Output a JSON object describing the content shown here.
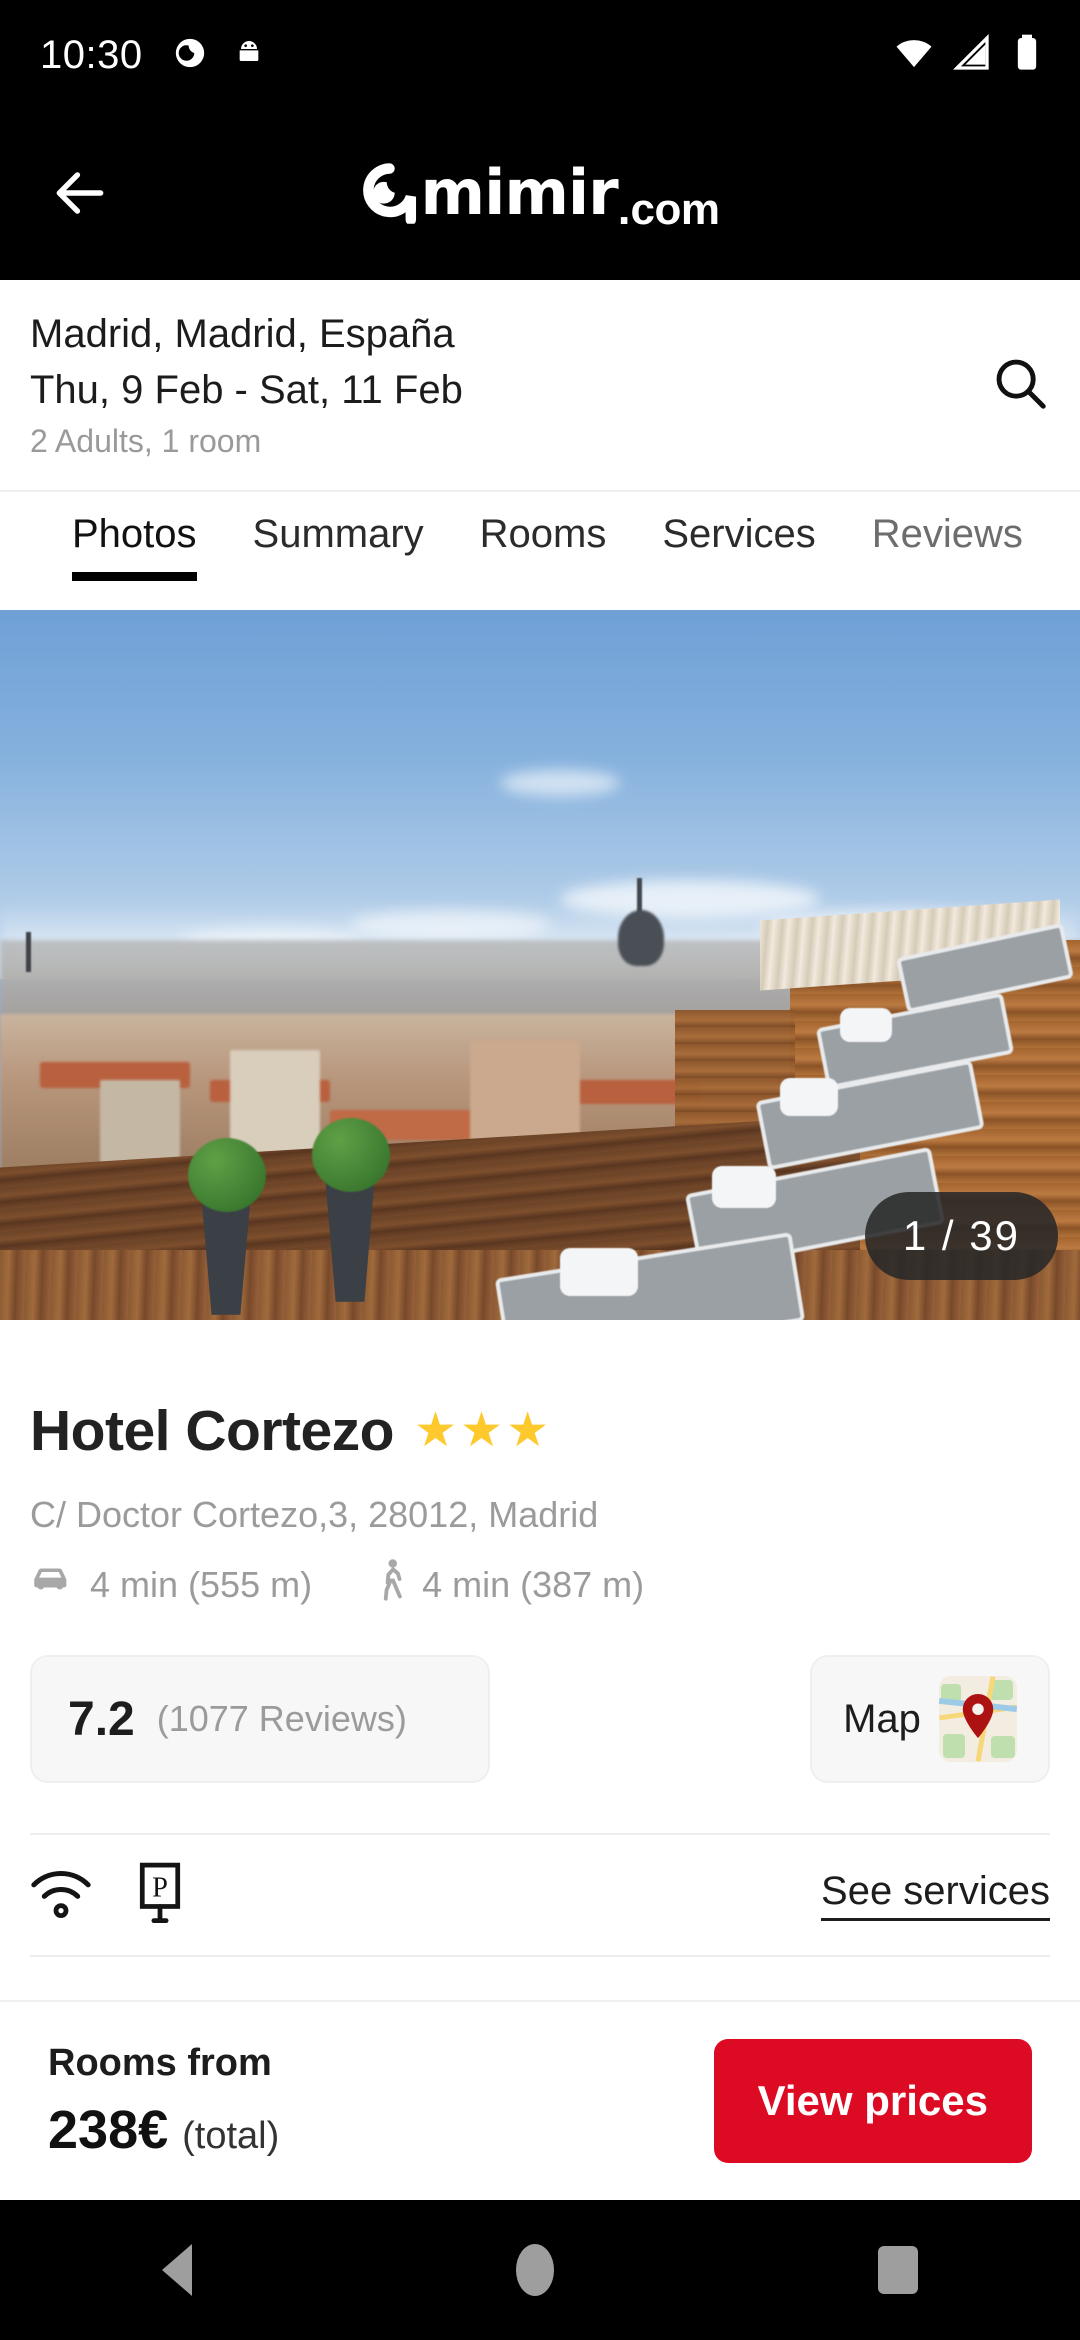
{
  "status_bar": {
    "time": "10:30",
    "icons": [
      "moon-do-not-disturb-icon",
      "android-head-icon",
      "wifi-icon",
      "cellular-signal-icon",
      "battery-full-icon"
    ]
  },
  "app_bar": {
    "back_icon": "back-arrow-icon",
    "logo": {
      "brand": "amimir",
      "dot": ".",
      "tld": "com",
      "full": "amimir.com"
    }
  },
  "search": {
    "destination": "Madrid, Madrid, España",
    "dates": "Thu, 9 Feb - Sat, 11 Feb",
    "occupancy": "2 Adults, 1 room",
    "search_icon": "search-icon"
  },
  "tabs": [
    {
      "label": "Photos",
      "active": true
    },
    {
      "label": "Summary",
      "active": false
    },
    {
      "label": "Rooms",
      "active": false
    },
    {
      "label": "Services",
      "active": false
    },
    {
      "label": "Reviews",
      "active": false
    }
  ],
  "gallery": {
    "counter": "1 / 39",
    "current": 1,
    "total": 39,
    "description": "Rooftop terrace with sun loungers overlooking Madrid skyline"
  },
  "hotel": {
    "name": "Hotel Cortezo",
    "star_rating": 3,
    "star_color": "#FDC92C",
    "address": "C/ Doctor Cortezo,3, 28012, Madrid",
    "distances": [
      {
        "mode": "car-icon",
        "time": "4 min",
        "distance": "(555 m)",
        "text": "4 min  (555 m)"
      },
      {
        "mode": "walk-icon",
        "time": "4 min",
        "distance": "(387 m)",
        "text": "4 min  (387 m)"
      }
    ],
    "rating": {
      "score": "7.2",
      "reviews": "(1077 Reviews)",
      "count": 1077
    },
    "map_button": {
      "label": "Map",
      "icon": "map-thumbnail-icon"
    }
  },
  "services": {
    "icons": [
      "wifi-icon",
      "parking-icon"
    ],
    "link_label": "See services"
  },
  "price_bar": {
    "rooms_from_label": "Rooms from",
    "amount": "238€",
    "qualifier": "(total)",
    "cta_label": "View prices",
    "cta_color": "#dc0a22"
  },
  "nav_bar": {
    "back": "nav-back-icon",
    "home": "nav-home-icon",
    "recents": "nav-recents-icon"
  }
}
